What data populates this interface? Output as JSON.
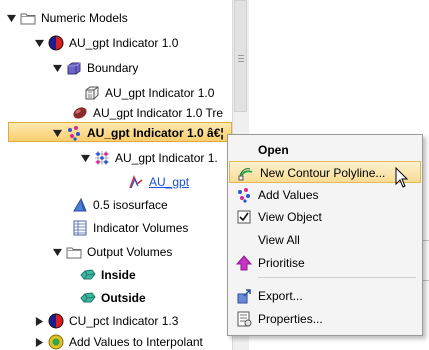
{
  "tree": {
    "items": [
      {
        "label": "Numeric Models",
        "icon": "folder-icon",
        "expand": "down"
      },
      {
        "label": "AU_gpt Indicator 1.0",
        "icon": "numeric-model-icon",
        "expand": "down"
      },
      {
        "label": "Boundary",
        "icon": "boundary-icon",
        "expand": "down"
      },
      {
        "label": "AU_gpt Indicator 1.0",
        "icon": "mesh-icon",
        "expand": ""
      },
      {
        "label": "AU_gpt Indicator 1.0 Tre",
        "icon": "trend-icon",
        "expand": ""
      },
      {
        "label": "AU_gpt Indicator 1.0 â€¦",
        "icon": "points-icon",
        "expand": "down"
      },
      {
        "label": "AU_gpt Indicator 1.",
        "icon": "points-grid-icon",
        "expand": "down"
      },
      {
        "label": "AU_gpt",
        "icon": "polyline-icon",
        "expand": ""
      },
      {
        "label": "0.5 isosurface",
        "icon": "isosurface-icon",
        "expand": ""
      },
      {
        "label": "Indicator Volumes",
        "icon": "table-icon",
        "expand": ""
      },
      {
        "label": "Output Volumes",
        "icon": "folder-icon",
        "expand": "down"
      },
      {
        "label": "Inside",
        "icon": "volume-icon",
        "expand": ""
      },
      {
        "label": "Outside",
        "icon": "volume-icon",
        "expand": ""
      },
      {
        "label": "CU_pct Indicator 1.3",
        "icon": "numeric-model-icon",
        "expand": "right"
      },
      {
        "label": "Add Values to Interpolant",
        "icon": "add-values-icon",
        "expand": "right"
      }
    ]
  },
  "context_menu": {
    "items": [
      {
        "label": "Open",
        "icon": ""
      },
      {
        "label": "New Contour Polyline...",
        "icon": "contour-polyline-icon"
      },
      {
        "label": "Add Values",
        "icon": "add-values-icon"
      },
      {
        "label": "View Object",
        "icon": "checkbox-checked-icon"
      },
      {
        "label": "View All",
        "icon": ""
      },
      {
        "label": "Prioritise",
        "icon": "up-arrow-icon"
      },
      {
        "label": "Export...",
        "icon": "export-icon"
      },
      {
        "label": "Properties...",
        "icon": "properties-icon"
      }
    ]
  },
  "colors": {
    "selection": "#f8cf6e",
    "menu_highlight": "#f8dc95",
    "link": "#1a4fd6"
  }
}
